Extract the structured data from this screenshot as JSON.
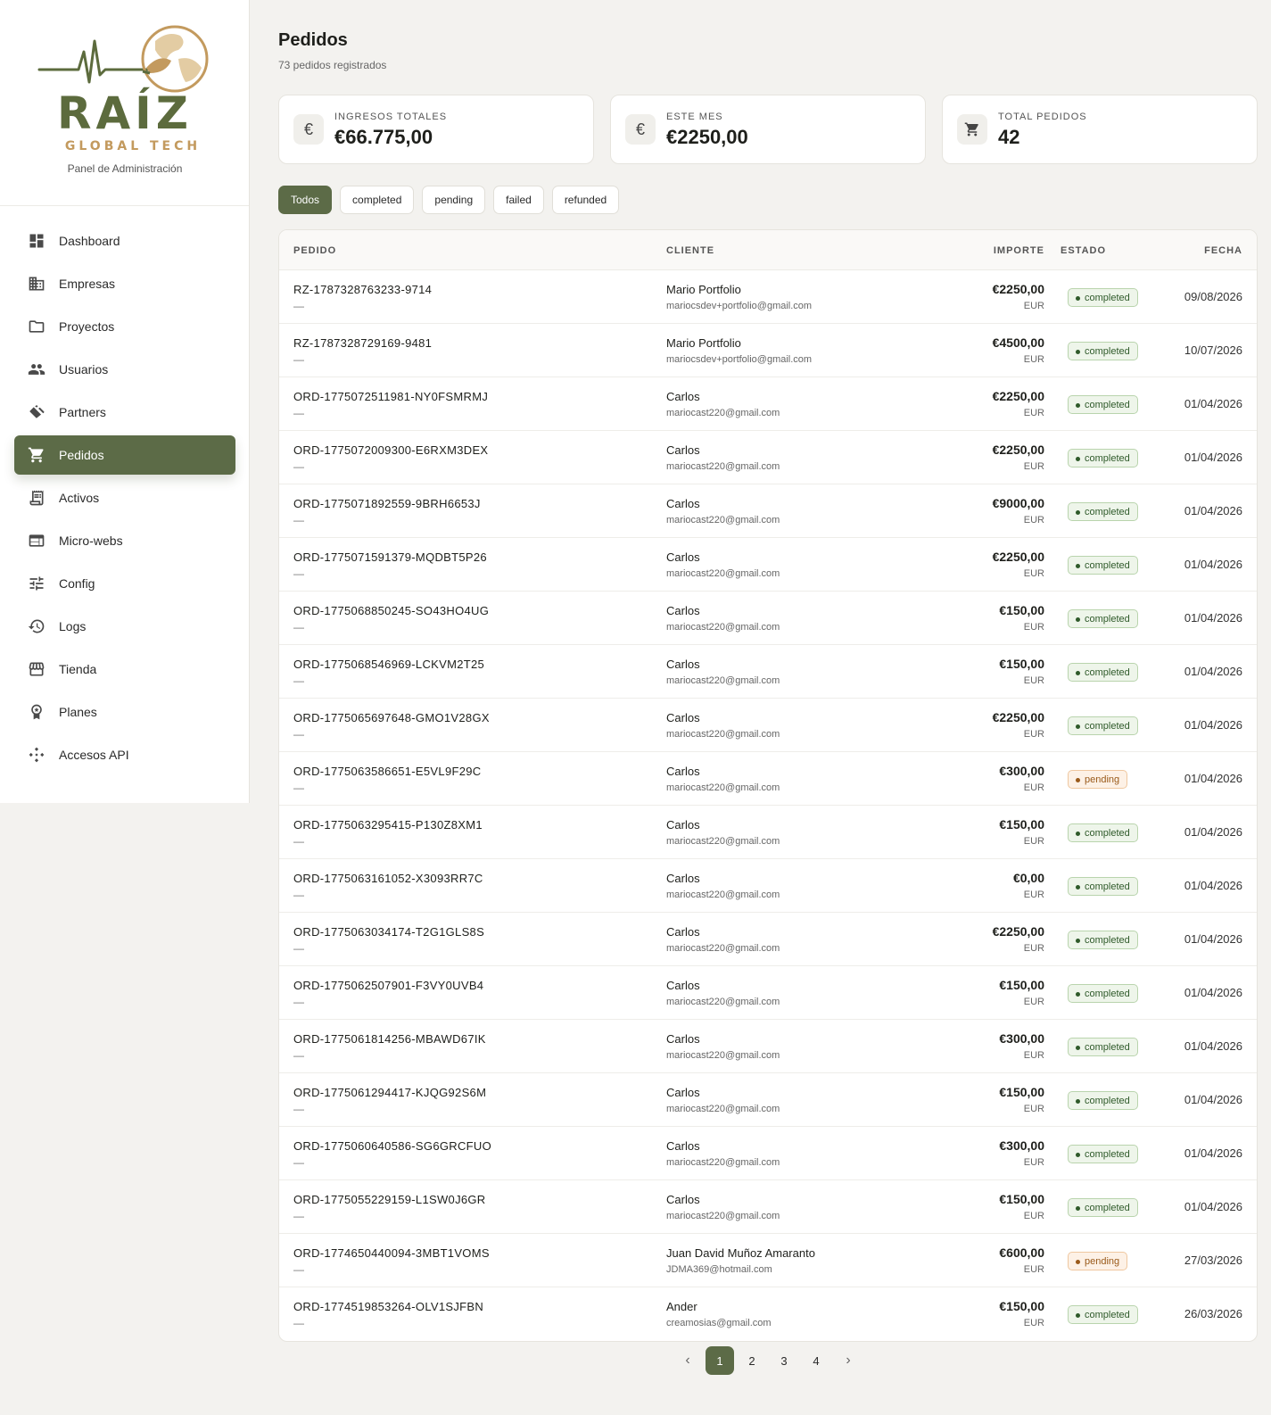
{
  "brand": {
    "name": "RAÍZ",
    "tagline": "GLOBAL TECH",
    "caption": "Panel de Administración",
    "colors": {
      "primary": "#5c6b47",
      "accent": "#c39a5e"
    }
  },
  "sidebar": {
    "items": [
      {
        "label": "Dashboard",
        "icon": "dashboard-icon"
      },
      {
        "label": "Empresas",
        "icon": "building-icon"
      },
      {
        "label": "Proyectos",
        "icon": "folder-icon"
      },
      {
        "label": "Usuarios",
        "icon": "users-icon"
      },
      {
        "label": "Partners",
        "icon": "handshake-icon"
      },
      {
        "label": "Pedidos",
        "icon": "cart-icon",
        "active": true
      },
      {
        "label": "Activos",
        "icon": "receipt-icon"
      },
      {
        "label": "Micro-webs",
        "icon": "web-icon"
      },
      {
        "label": "Config",
        "icon": "sliders-icon"
      },
      {
        "label": "Logs",
        "icon": "history-icon"
      },
      {
        "label": "Tienda",
        "icon": "store-icon"
      },
      {
        "label": "Planes",
        "icon": "badge-icon"
      },
      {
        "label": "Accesos API",
        "icon": "api-icon"
      }
    ]
  },
  "header": {
    "title": "Pedidos",
    "subtitle": "73 pedidos registrados"
  },
  "stats": [
    {
      "label": "INGRESOS TOTALES",
      "value": "€66.775,00",
      "icon": "euro-icon"
    },
    {
      "label": "ESTE MES",
      "value": "€2250,00",
      "icon": "euro-icon"
    },
    {
      "label": "TOTAL PEDIDOS",
      "value": "42",
      "icon": "cart-icon"
    }
  ],
  "filters": [
    {
      "label": "Todos",
      "active": true
    },
    {
      "label": "completed"
    },
    {
      "label": "pending"
    },
    {
      "label": "failed"
    },
    {
      "label": "refunded"
    }
  ],
  "table": {
    "columns": {
      "order": "PEDIDO",
      "client": "CLIENTE",
      "amount": "IMPORTE",
      "status": "ESTADO",
      "date": "FECHA"
    },
    "rows": [
      {
        "id": "RZ-1787328763233-9714",
        "sub": "—",
        "name": "Mario Portfolio",
        "email": "mariocsdev+portfolio@gmail.com",
        "amount": "€2250,00",
        "currency": "EUR",
        "status": "completed",
        "date": "09/08/2026"
      },
      {
        "id": "RZ-1787328729169-9481",
        "sub": "—",
        "name": "Mario Portfolio",
        "email": "mariocsdev+portfolio@gmail.com",
        "amount": "€4500,00",
        "currency": "EUR",
        "status": "completed",
        "date": "10/07/2026"
      },
      {
        "id": "ORD-1775072511981-NY0FSMRMJ",
        "sub": "—",
        "name": "Carlos",
        "email": "mariocast220@gmail.com",
        "amount": "€2250,00",
        "currency": "EUR",
        "status": "completed",
        "date": "01/04/2026"
      },
      {
        "id": "ORD-1775072009300-E6RXM3DEX",
        "sub": "—",
        "name": "Carlos",
        "email": "mariocast220@gmail.com",
        "amount": "€2250,00",
        "currency": "EUR",
        "status": "completed",
        "date": "01/04/2026"
      },
      {
        "id": "ORD-1775071892559-9BRH6653J",
        "sub": "—",
        "name": "Carlos",
        "email": "mariocast220@gmail.com",
        "amount": "€9000,00",
        "currency": "EUR",
        "status": "completed",
        "date": "01/04/2026"
      },
      {
        "id": "ORD-1775071591379-MQDBT5P26",
        "sub": "—",
        "name": "Carlos",
        "email": "mariocast220@gmail.com",
        "amount": "€2250,00",
        "currency": "EUR",
        "status": "completed",
        "date": "01/04/2026"
      },
      {
        "id": "ORD-1775068850245-SO43HO4UG",
        "sub": "—",
        "name": "Carlos",
        "email": "mariocast220@gmail.com",
        "amount": "€150,00",
        "currency": "EUR",
        "status": "completed",
        "date": "01/04/2026"
      },
      {
        "id": "ORD-1775068546969-LCKVM2T25",
        "sub": "—",
        "name": "Carlos",
        "email": "mariocast220@gmail.com",
        "amount": "€150,00",
        "currency": "EUR",
        "status": "completed",
        "date": "01/04/2026"
      },
      {
        "id": "ORD-1775065697648-GMO1V28GX",
        "sub": "—",
        "name": "Carlos",
        "email": "mariocast220@gmail.com",
        "amount": "€2250,00",
        "currency": "EUR",
        "status": "completed",
        "date": "01/04/2026"
      },
      {
        "id": "ORD-1775063586651-E5VL9F29C",
        "sub": "—",
        "name": "Carlos",
        "email": "mariocast220@gmail.com",
        "amount": "€300,00",
        "currency": "EUR",
        "status": "pending",
        "date": "01/04/2026"
      },
      {
        "id": "ORD-1775063295415-P130Z8XM1",
        "sub": "—",
        "name": "Carlos",
        "email": "mariocast220@gmail.com",
        "amount": "€150,00",
        "currency": "EUR",
        "status": "completed",
        "date": "01/04/2026"
      },
      {
        "id": "ORD-1775063161052-X3093RR7C",
        "sub": "—",
        "name": "Carlos",
        "email": "mariocast220@gmail.com",
        "amount": "€0,00",
        "currency": "EUR",
        "status": "completed",
        "date": "01/04/2026"
      },
      {
        "id": "ORD-1775063034174-T2G1GLS8S",
        "sub": "—",
        "name": "Carlos",
        "email": "mariocast220@gmail.com",
        "amount": "€2250,00",
        "currency": "EUR",
        "status": "completed",
        "date": "01/04/2026"
      },
      {
        "id": "ORD-1775062507901-F3VY0UVB4",
        "sub": "—",
        "name": "Carlos",
        "email": "mariocast220@gmail.com",
        "amount": "€150,00",
        "currency": "EUR",
        "status": "completed",
        "date": "01/04/2026"
      },
      {
        "id": "ORD-1775061814256-MBAWD67IK",
        "sub": "—",
        "name": "Carlos",
        "email": "mariocast220@gmail.com",
        "amount": "€300,00",
        "currency": "EUR",
        "status": "completed",
        "date": "01/04/2026"
      },
      {
        "id": "ORD-1775061294417-KJQG92S6M",
        "sub": "—",
        "name": "Carlos",
        "email": "mariocast220@gmail.com",
        "amount": "€150,00",
        "currency": "EUR",
        "status": "completed",
        "date": "01/04/2026"
      },
      {
        "id": "ORD-1775060640586-SG6GRCFUO",
        "sub": "—",
        "name": "Carlos",
        "email": "mariocast220@gmail.com",
        "amount": "€300,00",
        "currency": "EUR",
        "status": "completed",
        "date": "01/04/2026"
      },
      {
        "id": "ORD-1775055229159-L1SW0J6GR",
        "sub": "—",
        "name": "Carlos",
        "email": "mariocast220@gmail.com",
        "amount": "€150,00",
        "currency": "EUR",
        "status": "completed",
        "date": "01/04/2026"
      },
      {
        "id": "ORD-1774650440094-3MBT1VOMS",
        "sub": "—",
        "name": "Juan David Muñoz Amaranto",
        "email": "JDMA369@hotmail.com",
        "amount": "€600,00",
        "currency": "EUR",
        "status": "pending",
        "date": "27/03/2026"
      },
      {
        "id": "ORD-1774519853264-OLV1SJFBN",
        "sub": "—",
        "name": "Ander",
        "email": "creamosias@gmail.com",
        "amount": "€150,00",
        "currency": "EUR",
        "status": "completed",
        "date": "26/03/2026"
      }
    ]
  },
  "pagination": {
    "prev": "‹",
    "next": "›",
    "pages": [
      "1",
      "2",
      "3",
      "4"
    ],
    "current": "1"
  }
}
